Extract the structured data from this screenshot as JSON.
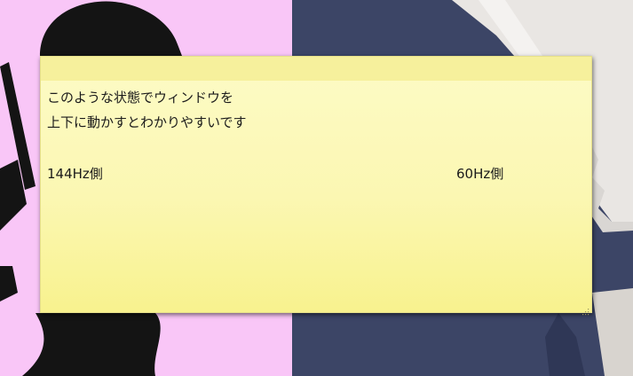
{
  "sticky_note": {
    "line_1": "このような状態でウィンドウを",
    "line_2": "上下に動かすとわかりやすいです",
    "label_left": "144Hz側",
    "label_right": "60Hz側"
  },
  "colors": {
    "wallpaper_left": "#f9c6f7",
    "wallpaper_right": "#3c4566",
    "note_background": "#fbf7b2",
    "note_title_bar": "#f6f09c"
  },
  "icons": {
    "resize_grip": "resize-grip-icon"
  }
}
